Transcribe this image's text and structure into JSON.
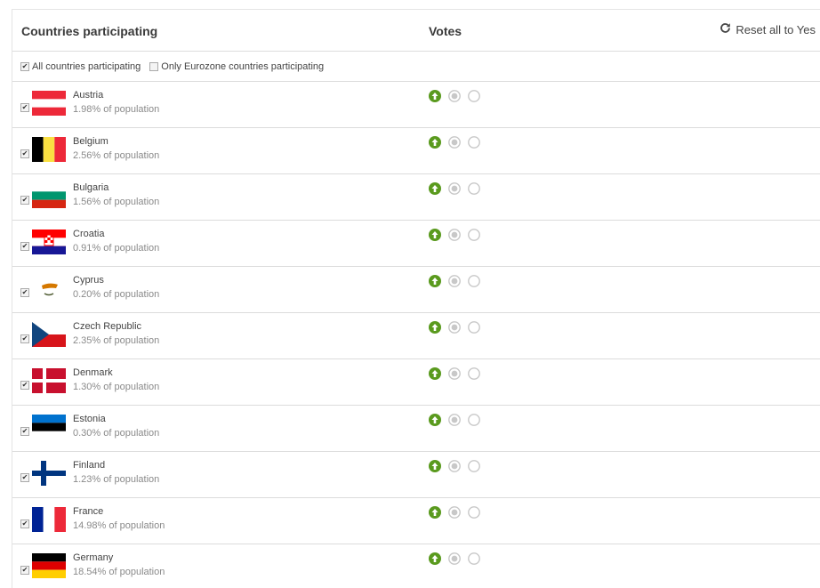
{
  "header": {
    "countries_label": "Countries participating",
    "votes_label": "Votes",
    "reset_label": "Reset all to Yes",
    "reset_icon": "refresh-icon"
  },
  "filters": [
    {
      "label": "All countries participating",
      "checked": true
    },
    {
      "label": "Only Eurozone countries participating",
      "checked": false
    }
  ],
  "countries": [
    {
      "name": "Austria",
      "population": "1.98% of population",
      "flag": "austria",
      "checked": true,
      "vote": "yes"
    },
    {
      "name": "Belgium",
      "population": "2.56% of population",
      "flag": "belgium",
      "checked": true,
      "vote": "yes"
    },
    {
      "name": "Bulgaria",
      "population": "1.56% of population",
      "flag": "bulgaria",
      "checked": true,
      "vote": "yes"
    },
    {
      "name": "Croatia",
      "population": "0.91% of population",
      "flag": "croatia",
      "checked": true,
      "vote": "yes"
    },
    {
      "name": "Cyprus",
      "population": "0.20% of population",
      "flag": "cyprus",
      "checked": true,
      "vote": "yes"
    },
    {
      "name": "Czech Republic",
      "population": "2.35% of population",
      "flag": "czech",
      "checked": true,
      "vote": "yes"
    },
    {
      "name": "Denmark",
      "population": "1.30% of population",
      "flag": "denmark",
      "checked": true,
      "vote": "yes"
    },
    {
      "name": "Estonia",
      "population": "0.30% of population",
      "flag": "estonia",
      "checked": true,
      "vote": "yes"
    },
    {
      "name": "Finland",
      "population": "1.23% of population",
      "flag": "finland",
      "checked": true,
      "vote": "yes"
    },
    {
      "name": "France",
      "population": "14.98% of population",
      "flag": "france",
      "checked": true,
      "vote": "yes"
    },
    {
      "name": "Germany",
      "population": "18.54% of population",
      "flag": "germany",
      "checked": true,
      "vote": "yes"
    }
  ],
  "colors": {
    "vote_yes": "#5a9a1e",
    "vote_inactive": "#c8c8c8",
    "border": "#dcdcdc"
  }
}
